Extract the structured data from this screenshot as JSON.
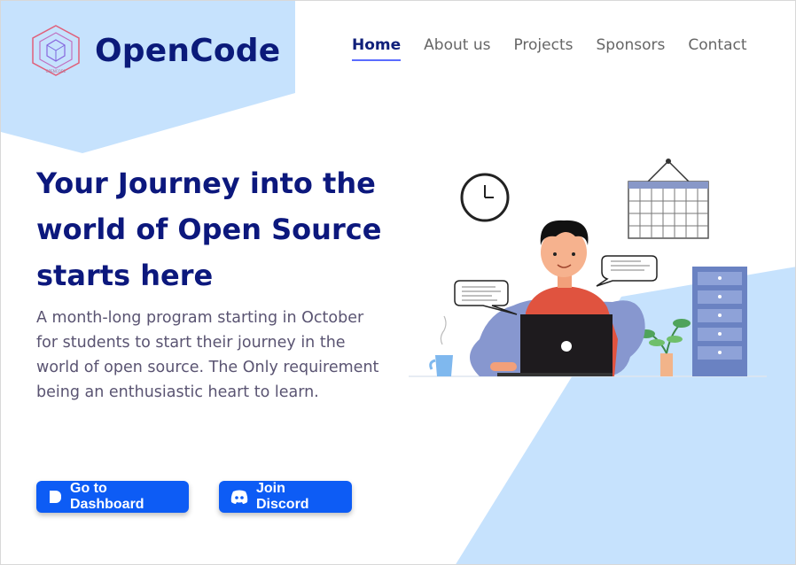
{
  "brand": {
    "name": "OpenCode",
    "logo_icon": "hexagon-cube-logo-icon",
    "logo_caption": "OPENCODE"
  },
  "nav": {
    "items": [
      {
        "label": "Home",
        "active": true
      },
      {
        "label": "About us",
        "active": false
      },
      {
        "label": "Projects",
        "active": false
      },
      {
        "label": "Sponsors",
        "active": false
      },
      {
        "label": "Contact",
        "active": false
      }
    ]
  },
  "hero": {
    "title": "Your Journey into the world of Open Source starts here",
    "description": "A month-long program starting in October for students to start their journey in the world of open source. The Only requirement being an enthusiastic heart to learn."
  },
  "buttons": {
    "dashboard": {
      "label": "Go to Dashboard",
      "icon": "dashboard-icon"
    },
    "discord": {
      "label": "Join Discord",
      "icon": "discord-icon"
    }
  },
  "illustration": {
    "description_icon": "person-with-laptop-illustration"
  },
  "colors": {
    "brand_navy": "#0c187d",
    "button_blue": "#0d5cf5",
    "accent_light_blue": "#c6e2fd",
    "nav_underline": "#5a6cff"
  }
}
